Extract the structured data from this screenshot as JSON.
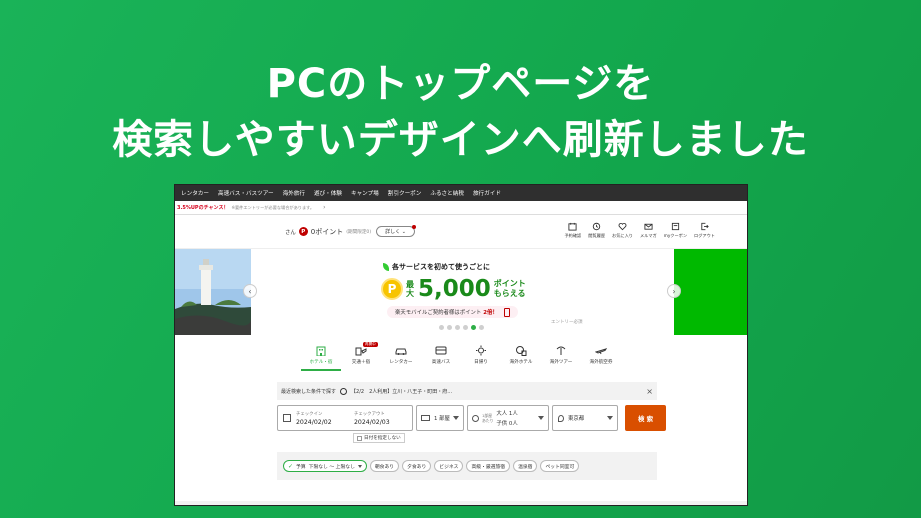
{
  "headline": {
    "line1": "PCのトップページを",
    "line2": "検索しやすいデザインへ刷新しました"
  },
  "nav": {
    "items": [
      "レンタカー",
      "高速バス・バスツアー",
      "海外旅行",
      "遊び・体験",
      "キャンプ場",
      "割引クーポン",
      "ふるさと納税",
      "旅行ガイド"
    ]
  },
  "notice": {
    "rate": "3.5%UPのチャンス！",
    "sub": "※要件エントリーが必要な場合があります。",
    "chevron": "›"
  },
  "user": {
    "name_suffix": "さん",
    "points": "0ポイント",
    "limited": "(期間限定0)",
    "detail_label": "詳しく",
    "icons": [
      {
        "name": "reservation-icon",
        "label": "予約確認"
      },
      {
        "name": "history-icon",
        "label": "閲覧履歴"
      },
      {
        "name": "heart-icon",
        "label": "お気に入り"
      },
      {
        "name": "mail-icon",
        "label": "メルマガ"
      },
      {
        "name": "coupon-icon",
        "label": "myクーポン"
      },
      {
        "name": "logout-icon",
        "label": "ログアウト"
      }
    ]
  },
  "banner": {
    "line1": "各サービスを初めて使うごとに",
    "p_mark": "P",
    "max": "最大",
    "amount": "5,000",
    "suffix_top": "ポイント",
    "suffix_bottom": "もらえる",
    "mobile_text": "楽天モバイルご契約者様はポイント",
    "mobile_highlight": "2倍！",
    "entry": "エントリー必須",
    "prev": "‹",
    "next": "›",
    "active_slide": 4,
    "slide_count": 6
  },
  "tabs": [
    {
      "name": "tab-hotel",
      "label": "ホテル・宿",
      "icon": "hotel-icon",
      "active": true
    },
    {
      "name": "tab-transport-hotel",
      "label": "交通＋宿",
      "icon": "transport-hotel-icon",
      "badge": "再開中"
    },
    {
      "name": "tab-rentacar",
      "label": "レンタカー",
      "icon": "car-icon"
    },
    {
      "name": "tab-highway-bus",
      "label": "高速バス",
      "icon": "bus-icon"
    },
    {
      "name": "tab-daytrip",
      "label": "日帰り",
      "icon": "sun-icon"
    },
    {
      "name": "tab-overseas-hotel",
      "label": "海外ホテル",
      "icon": "globe-hotel-icon"
    },
    {
      "name": "tab-overseas-tour",
      "label": "海外ツアー",
      "icon": "palm-icon"
    },
    {
      "name": "tab-overseas-air",
      "label": "海外航空券",
      "icon": "plane-icon"
    }
  ],
  "recent": {
    "label": "最近検索した条件で探す",
    "value": "【2/2　2人利用】立川・八王子・町田・府…",
    "close": "×"
  },
  "search": {
    "checkin_label": "チェックイン",
    "checkin_value": "2024/02/02",
    "checkout_label": "チェックアウト",
    "checkout_value": "2024/02/03",
    "rooms": "1 部屋",
    "guest_label1": "1部屋",
    "guest_label2": "あたり",
    "adults": "大人 1人",
    "children": "子供 0人",
    "area": "東京都",
    "button": "検 索",
    "nodate": "日付を指定しない"
  },
  "filters": {
    "budget_prefix": "予算",
    "budget_value": "下限なし ～ 上限なし",
    "chips": [
      "朝食あり",
      "夕食あり",
      "ビジネス",
      "高級・厳選旅宿",
      "温泉宿",
      "ペット同室可"
    ]
  },
  "colors": {
    "background": "#14aa50",
    "accent": "#2eae46",
    "brand_red": "#bf0000",
    "search_button": "#d94f00"
  }
}
